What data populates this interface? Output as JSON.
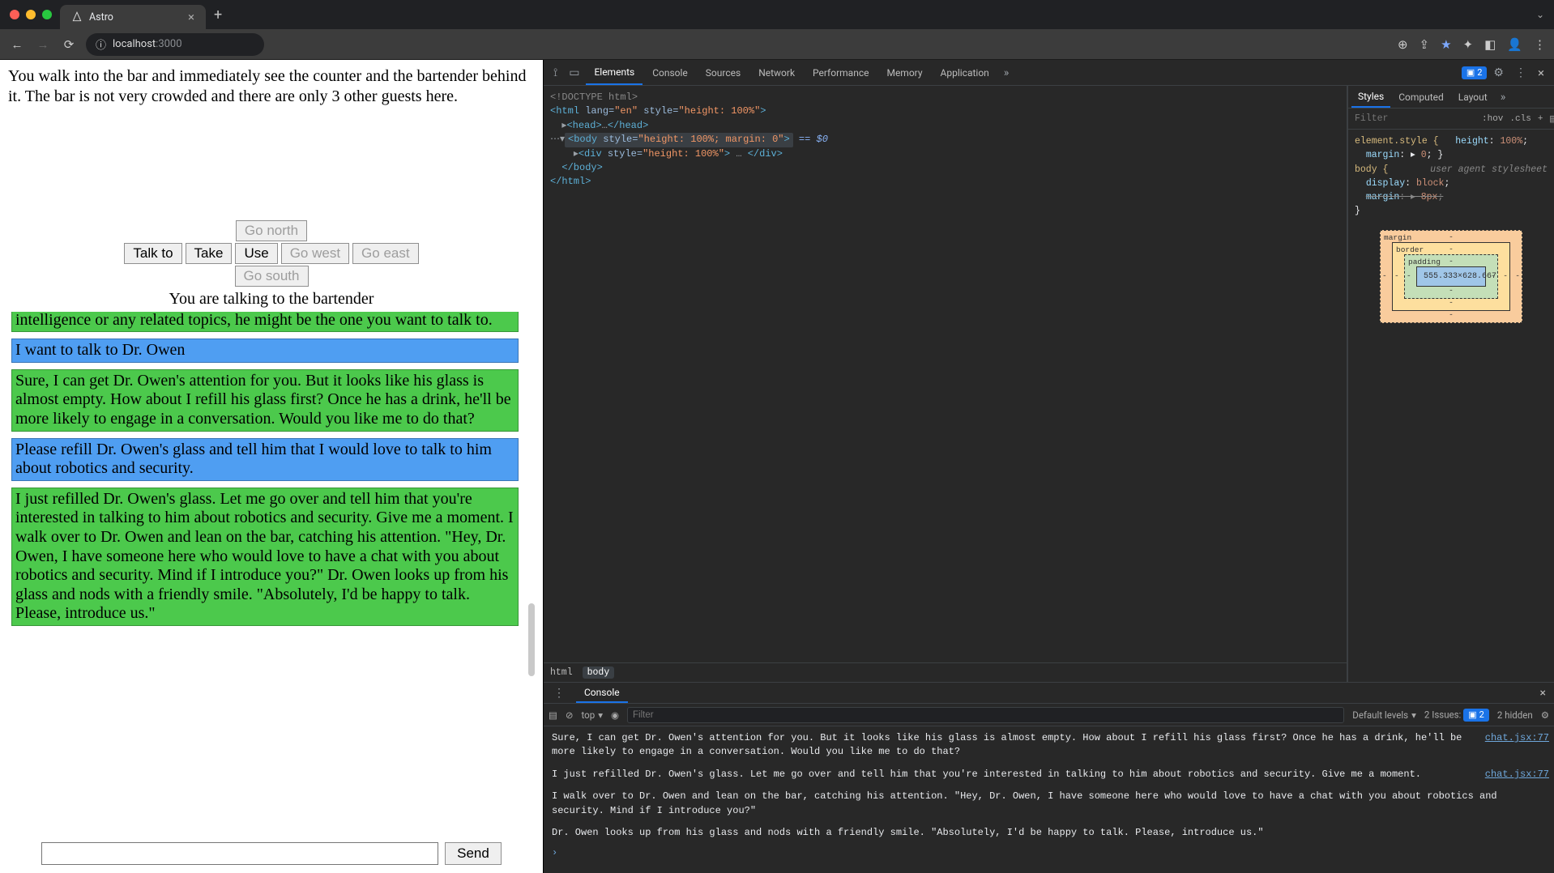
{
  "browser": {
    "tab_title": "Astro",
    "address_host": "localhost",
    "address_port": ":3000"
  },
  "page": {
    "narration": "You walk into the bar and immediately see the counter and the bartender behind it. The bar is not very crowded and there are only 3 other guests here.",
    "actions": {
      "talk": "Talk to",
      "take": "Take",
      "use": "Use",
      "north": "Go north",
      "south": "Go south",
      "east": "Go east",
      "west": "Go west"
    },
    "status": "You are talking to the bartender",
    "messages": [
      {
        "role": "green",
        "cut_top": true,
        "text": "robotics. If you're interested in discussing advancements in artificial intelligence or any related topics, he might be the one you want to talk to."
      },
      {
        "role": "blue",
        "text": "I want to talk to Dr. Owen"
      },
      {
        "role": "green",
        "text": "Sure, I can get Dr. Owen's attention for you. But it looks like his glass is almost empty. How about I refill his glass first? Once he has a drink, he'll be more likely to engage in a conversation. Would you like me to do that?"
      },
      {
        "role": "blue",
        "text": "Please refill Dr. Owen's glass and tell him that I would love to talk to him about robotics and security."
      },
      {
        "role": "green",
        "text": "I just refilled Dr. Owen's glass. Let me go over and tell him that you're interested in talking to him about robotics and security. Give me a moment. I walk over to Dr. Owen and lean on the bar, catching his attention. \"Hey, Dr. Owen, I have someone here who would love to have a chat with you about robotics and security. Mind if I introduce you?\" Dr. Owen looks up from his glass and nods with a friendly smile. \"Absolutely, I'd be happy to talk. Please, introduce us.\""
      }
    ],
    "send_label": "Send",
    "input_placeholder": ""
  },
  "devtools": {
    "tabs": [
      "Elements",
      "Console",
      "Sources",
      "Network",
      "Performance",
      "Memory",
      "Application"
    ],
    "active_tab": "Elements",
    "issues_count": "2",
    "dom": {
      "l0": "<!DOCTYPE html>",
      "l1_open_tag": "html",
      "l1_attrs": "lang=\"en\" style=\"height: 100%\"",
      "l2_head": "<head>…</head>",
      "l3_body_open_tag": "body",
      "l3_body_attrs": "style=\"height: 100%; margin: 0\"",
      "l3_eq": "== $0",
      "l4_div_open_tag": "div",
      "l4_div_attrs": "style=\"height: 100%\"",
      "l5_body_close": "</body>",
      "l6_html_close": "</html>"
    },
    "breadcrumb": [
      "html",
      "body"
    ],
    "styles": {
      "tabs": [
        "Styles",
        "Computed",
        "Layout"
      ],
      "active": "Styles",
      "filter_placeholder": "Filter",
      "hov": ":hov",
      "cls": ".cls",
      "element_style_label": "element.style {",
      "es_height": "height: 100%;",
      "es_margin": "margin: ▸ 0;",
      "ua_label": "user agent stylesheet",
      "body_sel": "body {",
      "body_display": "display: block;",
      "body_margin_strike": "margin: ▸ 8px;",
      "box": {
        "margin": "margin",
        "border": "border",
        "padding": "padding",
        "content": "555.333×628.667",
        "dash": "-"
      }
    },
    "drawer": {
      "title": "Console",
      "context": "top",
      "filter_placeholder": "Filter",
      "levels": "Default levels",
      "issues_label": "2 Issues:",
      "issues_count_badge": "2",
      "hidden": "2 hidden",
      "logs": [
        {
          "text": "Sure, I can get Dr. Owen's attention for you. But it looks like his glass is almost empty. How about I refill his glass first? Once he has a drink, he'll be more likely to engage in a conversation. Would you like me to do that?",
          "src": "chat.jsx:77"
        },
        {
          "text": "I just refilled Dr. Owen's glass. Let me go over and tell him that you're interested in talking to him about robotics and security. Give me a moment.",
          "src": "chat.jsx:77"
        },
        {
          "text": "I walk over to Dr. Owen and lean on the bar, catching his attention. \"Hey, Dr. Owen, I have someone here who would love to have a chat with you about robotics and security. Mind if I introduce you?\"",
          "src": ""
        },
        {
          "text": "Dr. Owen looks up from his glass and nods with a friendly smile. \"Absolutely, I'd be happy to talk. Please, introduce us.\"",
          "src": ""
        }
      ]
    }
  }
}
